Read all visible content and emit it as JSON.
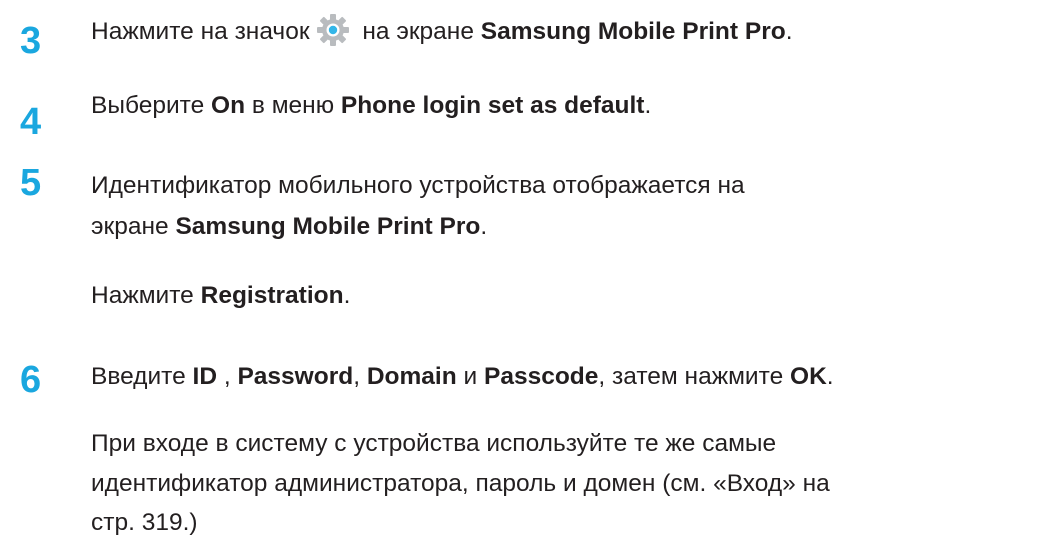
{
  "steps": [
    {
      "number": "3",
      "prefix": "Нажмите на значок",
      "icon": "settings-gear-icon",
      "middle": " на экране ",
      "app_name": "Samsung Mobile Print Pro",
      "suffix": "."
    },
    {
      "number": "4",
      "prefix": "Выберите ",
      "option": "On",
      "middle": " в меню ",
      "menu": "Phone login set as default",
      "suffix": "."
    },
    {
      "number": "5",
      "line1": "Идентификатор мобильного устройства отображается на",
      "line2_prefix": "экране ",
      "app_name": "Samsung Mobile Print Pro",
      "line2_suffix": ".",
      "sub_prefix": "Нажмите ",
      "sub_button": "Registration",
      "sub_suffix": "."
    },
    {
      "number": "6",
      "t1": "Введите ",
      "id": "ID",
      "t2": " , ",
      "password": "Password",
      "t3": ", ",
      "domain": "Domain",
      "t4": " и ",
      "passcode": "Passcode",
      "t5": ", затем нажмите ",
      "ok": "OK",
      "t6": ".",
      "note_line1": "При входе в систему с устройства используйте те же самые",
      "note_line2": "идентификатор администратора, пароль и домен (см. «Вход» на",
      "note_line3": "стр. 319.)"
    }
  ]
}
